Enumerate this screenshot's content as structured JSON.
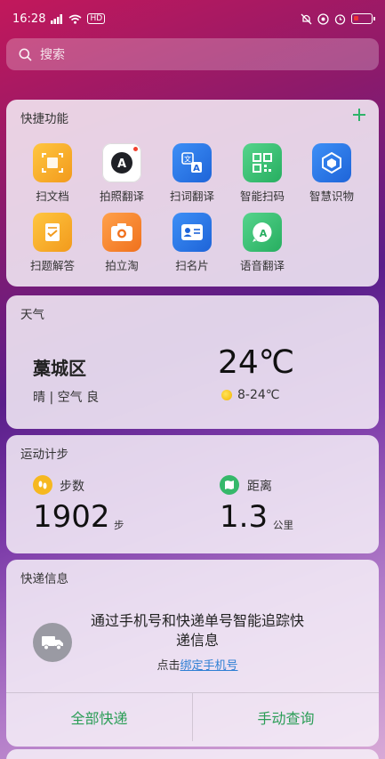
{
  "status_bar": {
    "time": "16:28",
    "network": "HD"
  },
  "search": {
    "placeholder": "搜索"
  },
  "shortcuts": {
    "title": "快捷功能",
    "items": [
      {
        "label": "扫文档",
        "icon": "scan-document-icon",
        "color": "#f6a623"
      },
      {
        "label": "拍照翻译",
        "icon": "photo-translate-icon",
        "color": "#ffffff"
      },
      {
        "label": "扫词翻译",
        "icon": "scan-word-translate-icon",
        "color": "#2f80ed"
      },
      {
        "label": "智能扫码",
        "icon": "qr-code-icon",
        "color": "#3cc27a"
      },
      {
        "label": "智慧识物",
        "icon": "object-recognition-icon",
        "color": "#2f80ed"
      },
      {
        "label": "扫题解答",
        "icon": "question-solve-icon",
        "color": "#f6a623"
      },
      {
        "label": "拍立淘",
        "icon": "camera-shop-icon",
        "color": "#f28a2d"
      },
      {
        "label": "扫名片",
        "icon": "business-card-icon",
        "color": "#2f80ed"
      },
      {
        "label": "语音翻译",
        "icon": "voice-translate-icon",
        "color": "#3cc27a"
      }
    ]
  },
  "weather": {
    "title": "天气",
    "city": "藁城区",
    "condition": "晴 | 空气 良",
    "temp": "24℃",
    "range": "8-24℃"
  },
  "steps": {
    "title": "运动计步",
    "steps_label": "步数",
    "steps_value": "1902",
    "steps_unit": "步",
    "distance_label": "距离",
    "distance_value": "1.3",
    "distance_unit": "公里"
  },
  "express": {
    "title": "快递信息",
    "message": "通过手机号和快递单号智能追踪快递信息",
    "bind_prefix": "点击",
    "bind_link": "绑定手机号",
    "all_button": "全部快递",
    "manual_button": "手动查询"
  },
  "colors": {
    "accent_green": "#2a9d56",
    "link_blue": "#2e7fd4"
  }
}
